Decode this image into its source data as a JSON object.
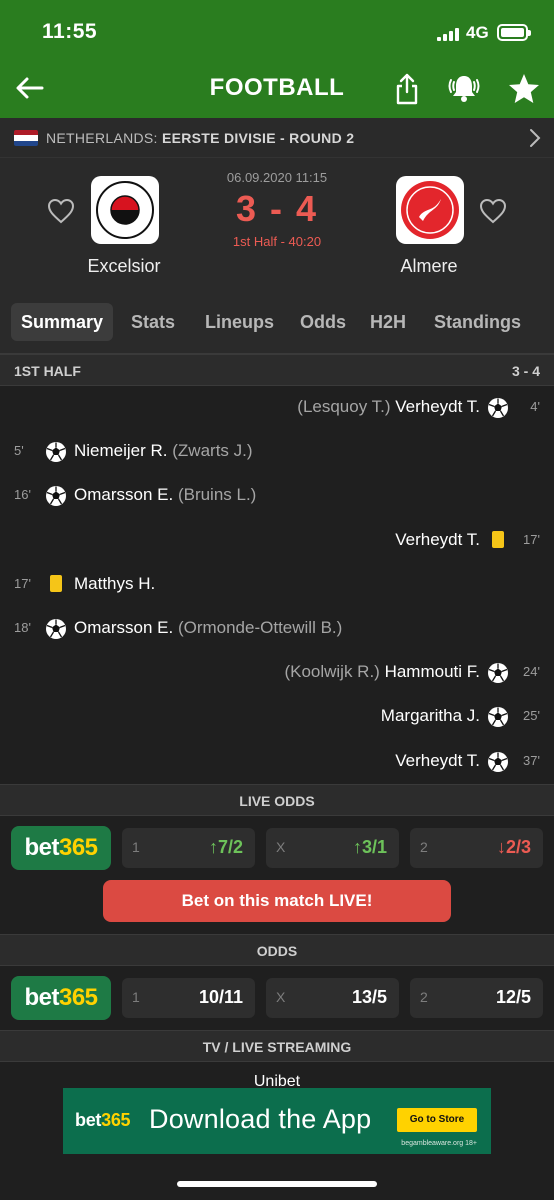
{
  "status_bar": {
    "time": "11:55",
    "network": "4G"
  },
  "nav": {
    "title": "FOOTBALL"
  },
  "league": {
    "country": "NETHERLANDS:",
    "competition": "EERSTE DIVISIE - ROUND 2"
  },
  "match": {
    "date": "06.09.2020 11:15",
    "score": "3 - 4",
    "period": "1st Half - 40:20",
    "home": {
      "name": "Excelsior",
      "logo_text": "S.B.V. EXCELSIOR"
    },
    "away": {
      "name": "Almere",
      "logo_text": "ALMERE CITY FOOTBALL CLUB"
    }
  },
  "tabs": [
    "Summary",
    "Stats",
    "Lineups",
    "Odds",
    "H2H",
    "Standings"
  ],
  "first_half": {
    "label": "1ST HALF",
    "score": "3 - 4"
  },
  "events": [
    {
      "side": "away",
      "type": "goal",
      "minute": "4'",
      "player": "Verheydt T.",
      "assist": "(Lesquoy T.)"
    },
    {
      "side": "home",
      "type": "goal",
      "minute": "5'",
      "player": "Niemeijer R.",
      "assist": "(Zwarts J.)"
    },
    {
      "side": "home",
      "type": "goal",
      "minute": "16'",
      "player": "Omarsson E.",
      "assist": "(Bruins L.)"
    },
    {
      "side": "away",
      "type": "yellow",
      "minute": "17'",
      "player": "Verheydt T.",
      "assist": ""
    },
    {
      "side": "home",
      "type": "yellow",
      "minute": "17'",
      "player": "Matthys H.",
      "assist": ""
    },
    {
      "side": "home",
      "type": "goal",
      "minute": "18'",
      "player": "Omarsson E.",
      "assist": "(Ormonde-Ottewill B.)"
    },
    {
      "side": "away",
      "type": "goal",
      "minute": "24'",
      "player": "Hammouti F.",
      "assist": "(Koolwijk R.)"
    },
    {
      "side": "away",
      "type": "goal",
      "minute": "25'",
      "player": "Margaritha J.",
      "assist": ""
    },
    {
      "side": "away",
      "type": "goal",
      "minute": "37'",
      "player": "Verheydt T.",
      "assist": ""
    }
  ],
  "live_odds": {
    "label": "LIVE ODDS",
    "bookmaker_a": "bet",
    "bookmaker_b": "365",
    "odds": [
      {
        "key": "1",
        "value": "7/2",
        "trend": "up",
        "arrow": "↑"
      },
      {
        "key": "X",
        "value": "3/1",
        "trend": "up",
        "arrow": "↑"
      },
      {
        "key": "2",
        "value": "2/3",
        "trend": "down",
        "arrow": "↓"
      }
    ],
    "cta": "Bet on this match LIVE!"
  },
  "odds": {
    "label": "ODDS",
    "bookmaker_a": "bet",
    "bookmaker_b": "365",
    "odds": [
      {
        "key": "1",
        "value": "10/11"
      },
      {
        "key": "X",
        "value": "13/5"
      },
      {
        "key": "2",
        "value": "12/5"
      }
    ]
  },
  "tv": {
    "label": "TV / LIVE STREAMING",
    "provider": "Unibet"
  },
  "ad": {
    "brand_a": "bet",
    "brand_b": "365",
    "headline": "Download the App",
    "cta": "Go to Store",
    "note": "begambleaware.org 18+"
  },
  "colors": {
    "header_green": "#2a7d1f",
    "score_red": "#ec5b53",
    "bet_green": "#1e7a45",
    "bet_yellow": "#ffd200",
    "odds_up": "#6dc25a"
  }
}
